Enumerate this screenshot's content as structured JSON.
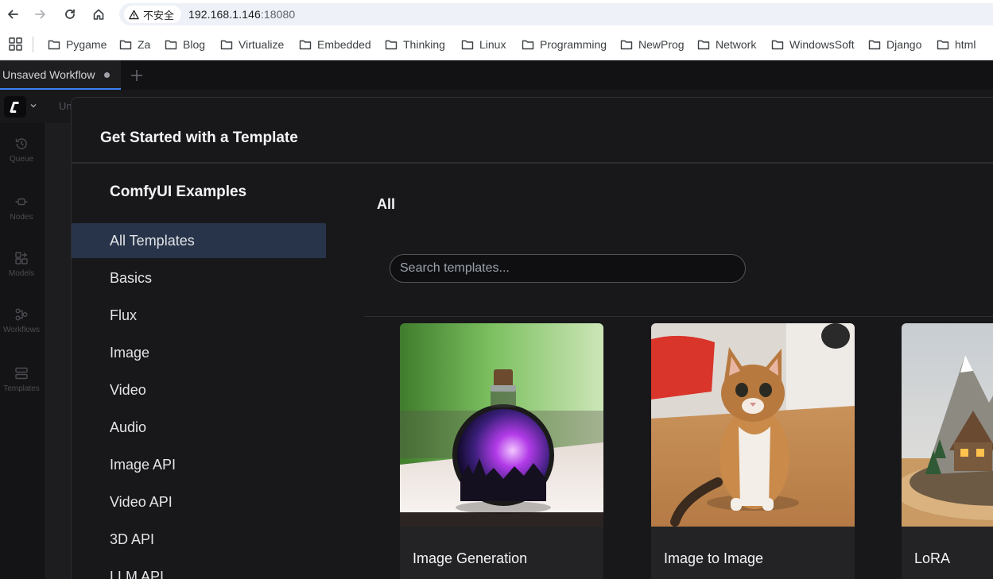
{
  "browser": {
    "security_label": "不安全",
    "url_host": "192.168.1.146",
    "url_port": ":18080",
    "bookmarks": [
      "Pygame",
      "Za",
      "Blog",
      "Virtualize",
      "Embedded",
      "Thinking",
      "Linux",
      "Programming",
      "NewProg",
      "Network",
      "WindowsSoft",
      "Django",
      "html"
    ]
  },
  "app": {
    "tab_title": "Unsaved Workflow",
    "breadcrumb_peek": "Un",
    "sidebar": {
      "queue": "Queue",
      "nodes": "Nodes",
      "models": "Models",
      "workflows": "Workflows",
      "templates": "Templates"
    }
  },
  "modal": {
    "title": "Get Started with a Template",
    "category_heading": "ComfyUI Examples",
    "categories": [
      "All Templates",
      "Basics",
      "Flux",
      "Image",
      "Video",
      "Audio",
      "Image API",
      "Video API",
      "3D API",
      "LLM API"
    ],
    "active_category": "All Templates",
    "content_heading": "All",
    "search_placeholder": "Search templates...",
    "cards": [
      {
        "title": "Image Generation"
      },
      {
        "title": "Image to Image"
      },
      {
        "title": "LoRA"
      }
    ]
  },
  "colors": {
    "accent": "#3b82f6",
    "active_category_bg": "#27344a",
    "modal_bg": "#18181b"
  }
}
